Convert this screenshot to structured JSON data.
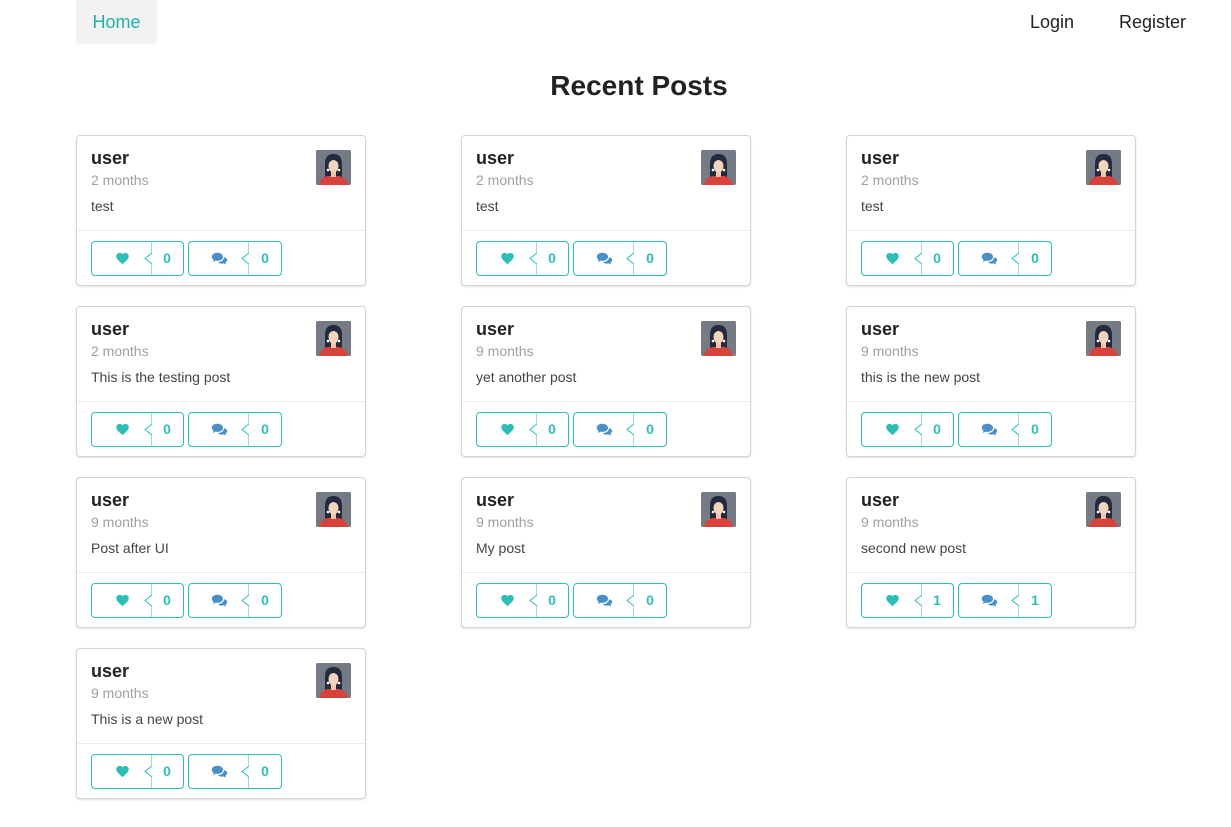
{
  "nav": {
    "home": "Home",
    "login": "Login",
    "register": "Register"
  },
  "title": "Recent Posts",
  "colors": {
    "accent": "#2bbfb7",
    "comment_icon": "#4a90c8"
  },
  "posts": [
    {
      "user": "user",
      "time": "2 months",
      "text": "test",
      "likes": "0",
      "comments": "0"
    },
    {
      "user": "user",
      "time": "2 months",
      "text": "test",
      "likes": "0",
      "comments": "0"
    },
    {
      "user": "user",
      "time": "2 months",
      "text": "test",
      "likes": "0",
      "comments": "0"
    },
    {
      "user": "user",
      "time": "2 months",
      "text": "This is the testing post",
      "likes": "0",
      "comments": "0"
    },
    {
      "user": "user",
      "time": "9 months",
      "text": "yet another post",
      "likes": "0",
      "comments": "0"
    },
    {
      "user": "user",
      "time": "9 months",
      "text": "this is the new post",
      "likes": "0",
      "comments": "0"
    },
    {
      "user": "user",
      "time": "9 months",
      "text": "Post after UI",
      "likes": "0",
      "comments": "0"
    },
    {
      "user": "user",
      "time": "9 months",
      "text": "My post",
      "likes": "0",
      "comments": "0"
    },
    {
      "user": "user",
      "time": "9 months",
      "text": "second new post",
      "likes": "1",
      "comments": "1"
    },
    {
      "user": "user",
      "time": "9 months",
      "text": "This is a new post",
      "likes": "0",
      "comments": "0"
    }
  ]
}
